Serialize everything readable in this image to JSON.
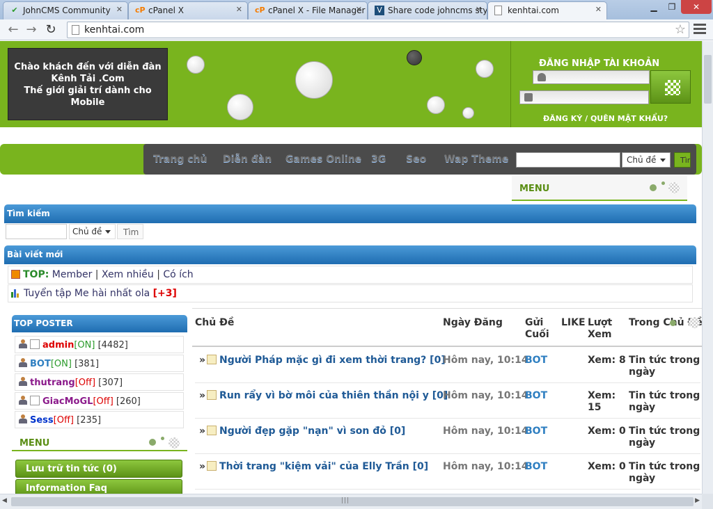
{
  "browser": {
    "tabs": [
      {
        "title": "JohnCMS Community",
        "icon": "checkmark-icon",
        "color": "#2a9a2a"
      },
      {
        "title": "cPanel X",
        "icon": "cpanel-icon",
        "color": "#f57c00"
      },
      {
        "title": "cPanel X - File Manager",
        "icon": "cpanel-icon",
        "color": "#f57c00"
      },
      {
        "title": "Share code johncms sty",
        "icon": "site-icon",
        "color": "#1d4e7a"
      },
      {
        "title": "kenhtai.com",
        "icon": "page-icon",
        "color": "#666666"
      }
    ],
    "url": "kenhtai.com"
  },
  "header": {
    "welcome_line1": "Chào khách đến với diễn đàn",
    "welcome_line2": "Kênh Tải .Com",
    "welcome_line3": "Thế giới giải trí dành cho",
    "welcome_line4": "Mobile",
    "login_title": "ĐĂNG NHẬP TÀI KHOẢN",
    "login_links": "ĐĂNG KÝ / QUÊN MẬT KHẨU?"
  },
  "nav": {
    "links": [
      "Trang chủ",
      "Diễn đàn",
      "Games Online",
      "3G",
      "Seo",
      "Wap Theme"
    ],
    "select_value": "Chủ đề",
    "go_label": "Tìm"
  },
  "menu_label": "MENU",
  "search": {
    "title": "Tìm kiếm",
    "select_value": "Chủ đề",
    "button": "Tìm"
  },
  "new_posts": {
    "title": "Bài viết mới",
    "top_label": "TOP:",
    "top_links": [
      "Member",
      "Xem nhiều",
      "Có ích"
    ],
    "featured_title": "Tuyển tập Me hài nhất ola",
    "featured_count": "[+3]"
  },
  "top_poster": {
    "title": "TOP POSTER",
    "users": [
      {
        "name": "admin",
        "status": "[ON]",
        "count": "[4482]",
        "name_color": "#dd0000",
        "status_color": "#2a9a2a",
        "checkbox": true
      },
      {
        "name": "BOT",
        "status": "[ON]",
        "count": "[381]",
        "name_color": "#2f7fc1",
        "status_color": "#2a9a2a",
        "checkbox": false
      },
      {
        "name": "thutrang",
        "status": "[Off]",
        "count": "[307]",
        "name_color": "#8b1a8b",
        "status_color": "#dd0000",
        "checkbox": false
      },
      {
        "name": "GiacMoGL",
        "status": "[Off]",
        "count": "[260]",
        "name_color": "#8b1a8b",
        "status_color": "#dd0000",
        "checkbox": true
      },
      {
        "name": "Sess",
        "status": "[Off]",
        "count": "[235]",
        "name_color": "#0033cc",
        "status_color": "#dd0000",
        "checkbox": false
      }
    ]
  },
  "left_menu": {
    "title": "MENU",
    "buttons": [
      "Lưu trữ tin tức (0)",
      "Information Faq"
    ]
  },
  "table": {
    "headers": {
      "topic": "Chủ Đề",
      "date": "Ngày Đăng",
      "last_line1": "Gửi",
      "last_line2": "Cuối",
      "like": "LIKE",
      "views_line1": "Lượt",
      "views_line2": "Xem",
      "category": "Trong Chủ Đề"
    },
    "rows": [
      {
        "title": "Người Pháp mặc gì đi xem thời trang? [0]",
        "date": "Hôm nay, 10:14",
        "last": "BOT",
        "views": "Xem: 8",
        "category": "Tin tức trong ngày"
      },
      {
        "title": "Run rẩy vì bờ môi của thiên thần nội y [0]",
        "date": "Hôm nay, 10:14",
        "last": "BOT",
        "views": "Xem: 15",
        "category": "Tin tức trong ngày"
      },
      {
        "title": "Người đẹp gặp \"nạn\" vì son đỏ [0]",
        "date": "Hôm nay, 10:14",
        "last": "BOT",
        "views": "Xem: 0",
        "category": "Tin tức trong ngày"
      },
      {
        "title": "Thời trang \"kiệm vải\" của Elly Trần [0]",
        "date": "Hôm nay, 10:14",
        "last": "BOT",
        "views": "Xem: 0",
        "category": "Tin tức trong ngày"
      }
    ]
  },
  "colors": {
    "brand_green": "#79b41e",
    "section_blue": "#1f6db1",
    "nav_dark": "#4b4b4b"
  }
}
